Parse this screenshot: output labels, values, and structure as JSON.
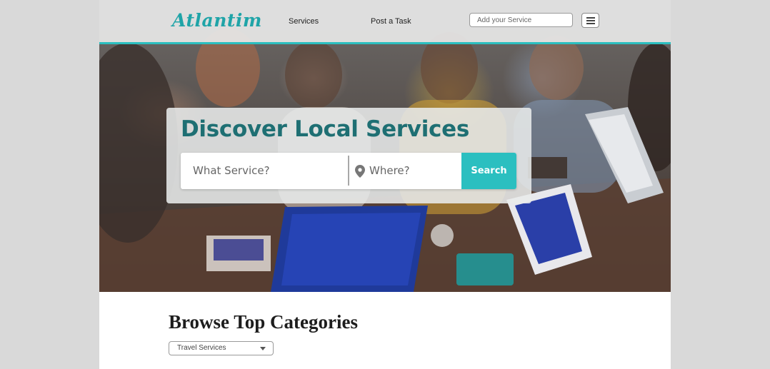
{
  "header": {
    "logo_text": "Atlantim",
    "nav": {
      "services": "Services",
      "post_task": "Post a Task"
    },
    "add_service_placeholder": "Add your Service",
    "menu_icon": "hamburger-menu-icon"
  },
  "hero": {
    "title": "Discover Local Services",
    "what_placeholder": "What Service?",
    "where_placeholder": "Where?",
    "where_icon": "location-pin-icon",
    "search_label": "Search"
  },
  "categories": {
    "title": "Browse Top Categories",
    "selected": "Travel Services"
  },
  "colors": {
    "accent": "#2bbfc0",
    "title_teal": "#1e6f73",
    "logo": "#1fa4a8"
  }
}
